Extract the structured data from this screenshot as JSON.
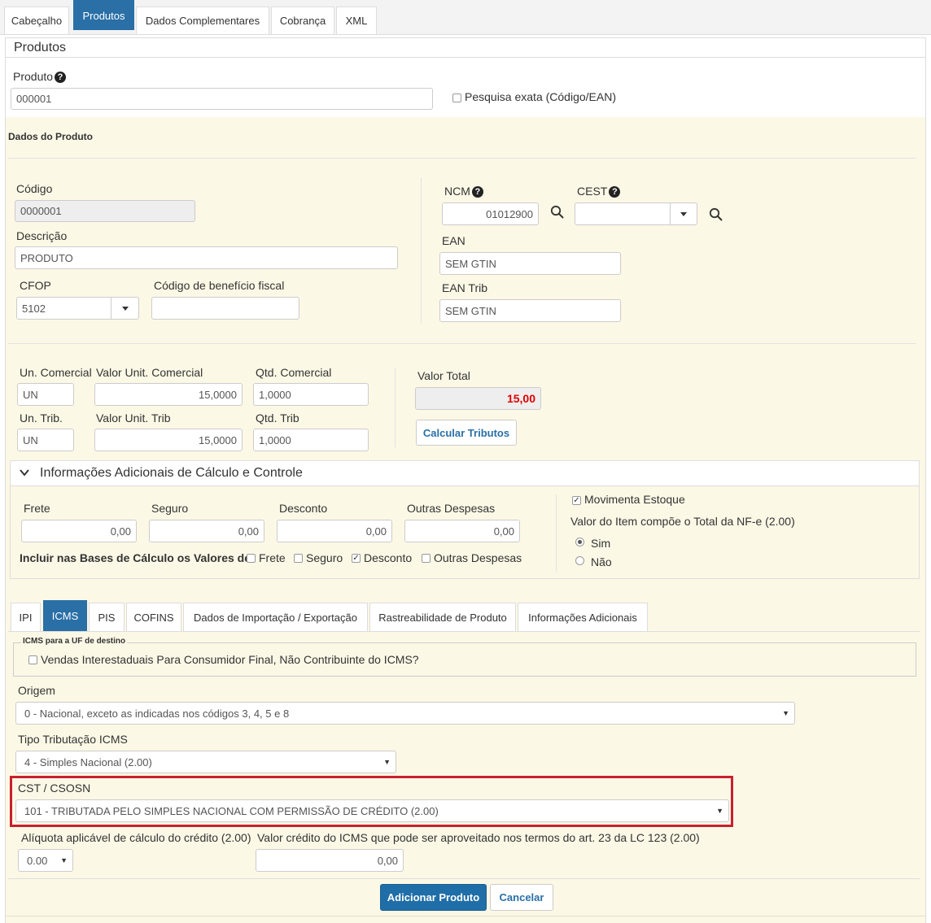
{
  "top_tabs": [
    "Cabeçalho",
    "Produtos",
    "Dados Complementares",
    "Cobrança",
    "XML"
  ],
  "panel_title": "Produtos",
  "produto": {
    "label": "Produto",
    "value": "000001",
    "exact_search_label": "Pesquisa exata (Código/EAN)"
  },
  "dados_produto": {
    "title": "Dados do Produto",
    "codigo_label": "Código",
    "codigo_value": "0000001",
    "descricao_label": "Descrição",
    "descricao_value": "PRODUTO",
    "cfop_label": "CFOP",
    "cfop_value": "5102",
    "beneficio_label": "Código de benefício fiscal",
    "beneficio_value": "",
    "ncm_label": "NCM",
    "ncm_value": "01012900",
    "cest_label": "CEST",
    "cest_value": "",
    "ean_label": "EAN",
    "ean_value": "SEM GTIN",
    "ean_trib_label": "EAN Trib",
    "ean_trib_value": "SEM GTIN"
  },
  "valores": {
    "un_comercial_label": "Un. Comercial",
    "un_comercial_value": "UN",
    "valor_unit_comercial_label": "Valor Unit. Comercial",
    "valor_unit_comercial_value": "15,0000",
    "qtd_comercial_label": "Qtd. Comercial",
    "qtd_comercial_value": "1,0000",
    "un_trib_label": "Un. Trib.",
    "un_trib_value": "UN",
    "valor_unit_trib_label": "Valor Unit. Trib",
    "valor_unit_trib_value": "15,0000",
    "qtd_trib_label": "Qtd. Trib",
    "qtd_trib_value": "1,0000",
    "valor_total_label": "Valor Total",
    "valor_total_value": "15,00",
    "calcular_label": "Calcular Tributos"
  },
  "adicionais": {
    "title": "Informações Adicionais de Cálculo e Controle",
    "frete_label": "Frete",
    "frete_value": "0,00",
    "seguro_label": "Seguro",
    "seguro_value": "0,00",
    "desconto_label": "Desconto",
    "desconto_value": "0,00",
    "outras_label": "Outras Despesas",
    "outras_value": "0,00",
    "incluir_label": "Incluir nas Bases de Cálculo os Valores de:",
    "chk_frete": "Frete",
    "chk_seguro": "Seguro",
    "chk_desconto": "Desconto",
    "chk_outras": "Outras Despesas",
    "movimenta_label": "Movimenta Estoque",
    "compoe_label": "Valor do Item compõe o Total da NF-e (2.00)",
    "sim_label": "Sim",
    "nao_label": "Não"
  },
  "sub_tabs": [
    "IPI",
    "ICMS",
    "PIS",
    "COFINS",
    "Dados de Importação / Exportação",
    "Rastreabilidade de Produto",
    "Informações Adicionais"
  ],
  "icms": {
    "uf_destino_legend": "ICMS para a UF de destino",
    "interestaduais_label": "Vendas Interestaduais Para Consumidor Final, Não Contribuinte do ICMS?",
    "origem_label": "Origem",
    "origem_value": "0 - Nacional, exceto as indicadas nos códigos 3, 4, 5 e 8",
    "tipo_label": "Tipo Tributação ICMS",
    "tipo_value": "4 - Simples Nacional (2.00)",
    "cst_label": "CST / CSOSN",
    "cst_value": "101 - TRIBUTADA PELO SIMPLES NACIONAL COM PERMISSÃO DE CRÉDITO (2.00)",
    "aliquota_label": "Alíquota aplicável de cálculo do crédito (2.00)",
    "aliquota_value": "0.00",
    "credito_label": "Valor crédito do ICMS que pode ser aproveitado nos termos do art. 23 da LC 123 (2.00)",
    "credito_value": "0,00"
  },
  "buttons": {
    "adicionar": "Adicionar Produto",
    "cancelar": "Cancelar"
  },
  "colors": {
    "accent": "#2a6fa6",
    "highlight": "#c9202e",
    "total_red": "#e00000",
    "section_bg": "#fcf8e6"
  }
}
